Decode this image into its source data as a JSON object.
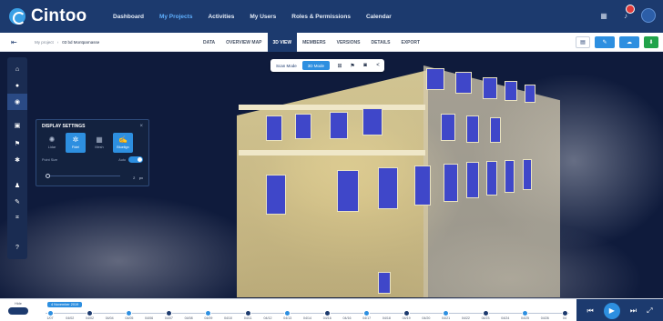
{
  "app": {
    "brand": "Cintoo"
  },
  "topnav": {
    "items": [
      {
        "label": "Dashboard"
      },
      {
        "label": "My Projects"
      },
      {
        "label": "Activities"
      },
      {
        "label": "My Users"
      },
      {
        "label": "Roles & Permissions"
      },
      {
        "label": "Calendar"
      }
    ],
    "active_index": 1,
    "icons": [
      "grid-icon",
      "bell-icon",
      "user-avatar"
    ]
  },
  "subheader": {
    "breadcrumb": [
      "My project",
      "03 bd Montparnasse"
    ],
    "tabs": [
      {
        "label": "DATA"
      },
      {
        "label": "OVERVIEW MAP"
      },
      {
        "label": "3D VIEW"
      },
      {
        "label": "MEMBERS"
      },
      {
        "label": "VERSIONS"
      },
      {
        "label": "DETAILS"
      },
      {
        "label": "EXPORT"
      }
    ],
    "active_tab_index": 2
  },
  "viewer_toolbar": {
    "scan_mode": "Scan Mode",
    "unified_mode": "3D Mode",
    "icons": [
      "measure-icon",
      "flag-icon",
      "camera-icon",
      "share-icon"
    ]
  },
  "display_settings": {
    "title": "DISPLAY SETTINGS",
    "modes": [
      {
        "label": "Lidar",
        "icon": "lidar-icon"
      },
      {
        "label": "Fidel",
        "icon": "fidel-icon"
      },
      {
        "label": "Mesh",
        "icon": "mesh-icon"
      },
      {
        "label": "Bluelign",
        "icon": "bluelign-icon"
      }
    ],
    "active_modes": [
      1,
      3
    ],
    "point_size_label": "Point Size",
    "auto_label": "Auto",
    "toggle_value": "ON",
    "point_size_value": "2",
    "point_size_unit": "px"
  },
  "timeline": {
    "label": "Hide",
    "selected_date": "4 November 2019",
    "dates": [
      "1/07",
      "04/02",
      "04/02",
      "04/04",
      "04/05",
      "04/06",
      "04/07",
      "04/08",
      "04/09",
      "04/10",
      "04/11",
      "04/12",
      "04/13",
      "04/14",
      "04/16",
      "04/16",
      "04/17",
      "04/18",
      "04/19",
      "04/20",
      "04/21",
      "04/22",
      "04/23",
      "04/24",
      "04/25",
      "04/26",
      "04"
    ]
  }
}
